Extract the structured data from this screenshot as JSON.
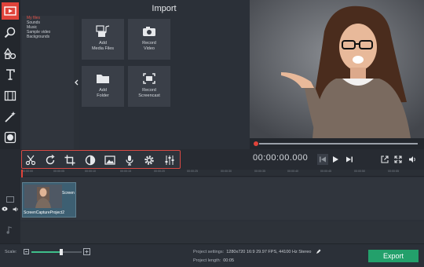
{
  "import": {
    "title": "Import",
    "tree": [
      "My files",
      "Sounds",
      "Music",
      "Sample video",
      "Backgrounds"
    ],
    "cards": [
      {
        "label": "Add\nMedia Files",
        "icon": "add-media-icon"
      },
      {
        "label": "Record\nVideo",
        "icon": "camera-icon"
      },
      {
        "label": "Add\nFolder",
        "icon": "folder-icon"
      },
      {
        "label": "Record\nScreencast",
        "icon": "screencast-icon"
      }
    ]
  },
  "player": {
    "timecode": "00:00:00.000"
  },
  "ruler": {
    "ticks": [
      "00:00:00",
      "00:00:05",
      "00:00:10",
      "00:00:15",
      "00:00:20",
      "00:00:25",
      "00:00:30",
      "00:00:35",
      "00:00:40",
      "00:00:45",
      "00:00:50",
      "00:00:55"
    ]
  },
  "timeline": {
    "clip_name": "ScreenCaptureProject2",
    "clip_thumb_text": "Screen"
  },
  "status": {
    "scale_label": "Scale:",
    "settings_label": "Project settings:",
    "settings_value": "1280x720 16:9 29.97 FPS, 44100 Hz Stereo",
    "length_label": "Project length:",
    "length_value": "00:05",
    "export_label": "Export"
  },
  "colors": {
    "accent": "#e0433a",
    "export": "#23a06b"
  }
}
